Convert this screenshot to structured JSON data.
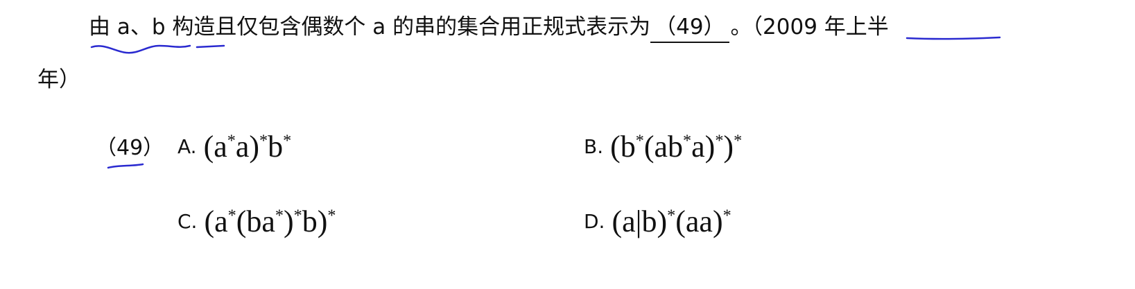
{
  "question": {
    "line1_text": "由 a、b 构造且仅包含偶数个 a 的串的集合用正规式表示为",
    "blank_label": "（49）",
    "after_blank": "。（2009 年上半",
    "line2_text": "年）"
  },
  "options": {
    "number_label": "（49）",
    "a": {
      "letter": "A.",
      "formula": "(a*a)*b*"
    },
    "b": {
      "letter": "B.",
      "formula": "(b*(ab*a)*)*"
    },
    "c": {
      "letter": "C.",
      "formula": "(a*(ba*)*b)*"
    },
    "d": {
      "letter": "D.",
      "formula": "(a|b)*(aa)*"
    }
  },
  "annotation_color": "#2a2ad0"
}
